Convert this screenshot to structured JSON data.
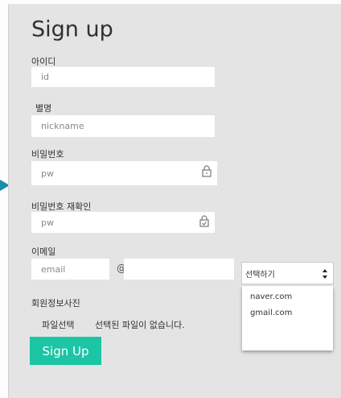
{
  "title": "Sign up",
  "fields": {
    "id": {
      "label": "아이디",
      "placeholder": "id"
    },
    "nickname": {
      "label": "별명",
      "placeholder": "nickname"
    },
    "password": {
      "label": "비밀번호",
      "placeholder": "pw"
    },
    "password_confirm": {
      "label": "비밀번호 재확인",
      "placeholder": "pw"
    },
    "email": {
      "label": "이메일",
      "placeholder": "email",
      "at": "@"
    }
  },
  "domain_select": {
    "selected": "선택하기",
    "options": [
      "naver.com",
      "gmail.com"
    ]
  },
  "profile_photo": {
    "label": "회원정보사진",
    "button": "파일선택",
    "status": "선택된 파일이 없습니다."
  },
  "submit_label": "Sign Up",
  "colors": {
    "accent": "#1bc5a6",
    "panel": "#e4e4e4",
    "arrow": "#1a8ea8"
  }
}
